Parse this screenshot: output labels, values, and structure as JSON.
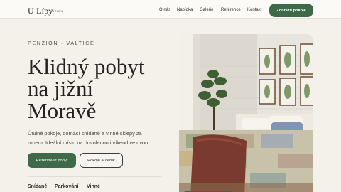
{
  "nav": {
    "brand": "U Lípy",
    "brand_sub": "PENZION",
    "links": [
      "O nás",
      "Nabídka",
      "Galerie",
      "Reference",
      "Kontakt"
    ],
    "cta": "Zobrazit pokoje"
  },
  "hero": {
    "eyebrow": "PENZION · VALTICE",
    "title_lines": [
      "Klidný pobyt",
      "na jižní",
      "Moravě"
    ],
    "description_lines": [
      "Útulné pokoje, domácí snídaně a vinné sklepy za",
      "rohem. Ideální místo na dovolenou i víkend ve dvou."
    ],
    "primary_button": "Rezervovat pobyt",
    "secondary_button": "Pokoje & ceník",
    "features": [
      "Snídaně",
      "Parkování",
      "Vinné"
    ]
  },
  "colors": {
    "accent": "#3e6a4a",
    "background": "#f4f1eb"
  }
}
